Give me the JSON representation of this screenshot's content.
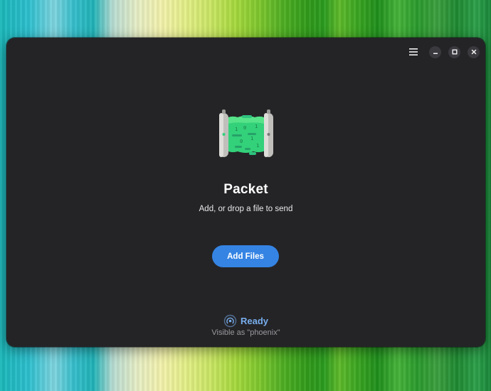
{
  "window": {
    "controls": {
      "menu_icon": "hamburger-menu-icon",
      "minimize_icon": "minimize-icon",
      "maximize_icon": "maximize-icon",
      "close_icon": "close-icon"
    }
  },
  "main": {
    "app_icon": "packet-app-icon",
    "title": "Packet",
    "subtitle": "Add, or drop a file to send",
    "add_files_label": "Add Files"
  },
  "status": {
    "icon": "broadcast-signal-icon",
    "text": "Ready",
    "visible_as": "Visible as \"phoenix\""
  },
  "colors": {
    "window_bg": "#242427",
    "accent": "#3584e4",
    "status_blue": "#78aeed",
    "icon_green": "#33d17a"
  }
}
